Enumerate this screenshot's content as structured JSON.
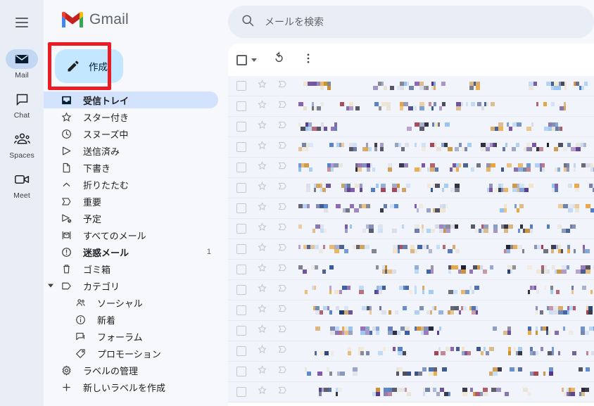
{
  "app": {
    "brand_name": "Gmail",
    "menu_icon": "hamburger-icon"
  },
  "rail": {
    "items": [
      {
        "label": "Mail",
        "icon": "mail-icon",
        "active": true
      },
      {
        "label": "Chat",
        "icon": "chat-icon",
        "active": false
      },
      {
        "label": "Spaces",
        "icon": "spaces-icon",
        "active": false
      },
      {
        "label": "Meet",
        "icon": "meet-icon",
        "active": false
      }
    ]
  },
  "compose": {
    "label": "作成",
    "icon": "pencil-icon",
    "highlighted": true,
    "highlight_color": "#ec1c24"
  },
  "sidebar": {
    "items": [
      {
        "label": "受信トレイ",
        "icon": "inbox-icon",
        "selected": true,
        "indent": 0,
        "count": ""
      },
      {
        "label": "スター付き",
        "icon": "star-icon",
        "selected": false,
        "indent": 0,
        "count": ""
      },
      {
        "label": "スヌーズ中",
        "icon": "clock-icon",
        "selected": false,
        "indent": 0,
        "count": ""
      },
      {
        "label": "送信済み",
        "icon": "send-icon",
        "selected": false,
        "indent": 0,
        "count": ""
      },
      {
        "label": "下書き",
        "icon": "draft-icon",
        "selected": false,
        "indent": 0,
        "count": ""
      },
      {
        "label": "折りたたむ",
        "icon": "chevron-up-icon",
        "selected": false,
        "indent": 0,
        "count": ""
      },
      {
        "label": "重要",
        "icon": "important-icon",
        "selected": false,
        "indent": 0,
        "count": ""
      },
      {
        "label": "予定",
        "icon": "scheduled-icon",
        "selected": false,
        "indent": 0,
        "count": ""
      },
      {
        "label": "すべてのメール",
        "icon": "all-mail-icon",
        "selected": false,
        "indent": 0,
        "count": ""
      },
      {
        "label": "迷惑メール",
        "icon": "spam-icon",
        "selected": false,
        "indent": 0,
        "count": "1",
        "bold": true
      },
      {
        "label": "ゴミ箱",
        "icon": "trash-icon",
        "selected": false,
        "indent": 0,
        "count": ""
      },
      {
        "label": "カテゴリ",
        "icon": "label-icon",
        "selected": false,
        "indent": 0,
        "count": "",
        "caret": true
      },
      {
        "label": "ソーシャル",
        "icon": "social-icon",
        "selected": false,
        "indent": 1,
        "count": ""
      },
      {
        "label": "新着",
        "icon": "updates-icon",
        "selected": false,
        "indent": 1,
        "count": ""
      },
      {
        "label": "フォーラム",
        "icon": "forums-icon",
        "selected": false,
        "indent": 1,
        "count": ""
      },
      {
        "label": "プロモーション",
        "icon": "promotions-icon",
        "selected": false,
        "indent": 1,
        "count": ""
      },
      {
        "label": "ラベルの管理",
        "icon": "gear-icon",
        "selected": false,
        "indent": 0,
        "count": ""
      },
      {
        "label": "新しいラベルを作成",
        "icon": "plus-icon",
        "selected": false,
        "indent": 0,
        "count": ""
      }
    ]
  },
  "search": {
    "placeholder": "メールを検索",
    "value": "",
    "icon": "search-icon"
  },
  "list_toolbar": {
    "select_all": "select-all-checkbox",
    "select_all_caret": "chevron-down-icon",
    "refresh": "refresh-icon",
    "more": "more-options-icon"
  },
  "message_list": {
    "redacted": true,
    "row_count": 16,
    "rows": [
      {
        "checkbox": false,
        "starred": false,
        "important": false
      },
      {
        "checkbox": false,
        "starred": false,
        "important": false
      },
      {
        "checkbox": false,
        "starred": false,
        "important": false
      },
      {
        "checkbox": false,
        "starred": false,
        "important": false
      },
      {
        "checkbox": false,
        "starred": false,
        "important": false
      },
      {
        "checkbox": false,
        "starred": false,
        "important": false
      },
      {
        "checkbox": false,
        "starred": false,
        "important": false
      },
      {
        "checkbox": false,
        "starred": false,
        "important": false
      },
      {
        "checkbox": false,
        "starred": false,
        "important": false
      },
      {
        "checkbox": false,
        "starred": false,
        "important": false
      },
      {
        "checkbox": false,
        "starred": false,
        "important": false
      },
      {
        "checkbox": false,
        "starred": false,
        "important": false
      },
      {
        "checkbox": false,
        "starred": false,
        "important": false
      },
      {
        "checkbox": false,
        "starred": false,
        "important": false
      },
      {
        "checkbox": false,
        "starred": false,
        "important": false
      },
      {
        "checkbox": false,
        "starred": false,
        "important": false
      }
    ]
  },
  "colors": {
    "accent_blue": "#c2e7ff",
    "selected_blue": "#d3e3fd",
    "rail_bg": "#e9eef6",
    "sidebar_bg": "#f6f8fc",
    "list_row_bg": "#f2f4fb",
    "annotation_red": "#ec1c24"
  }
}
